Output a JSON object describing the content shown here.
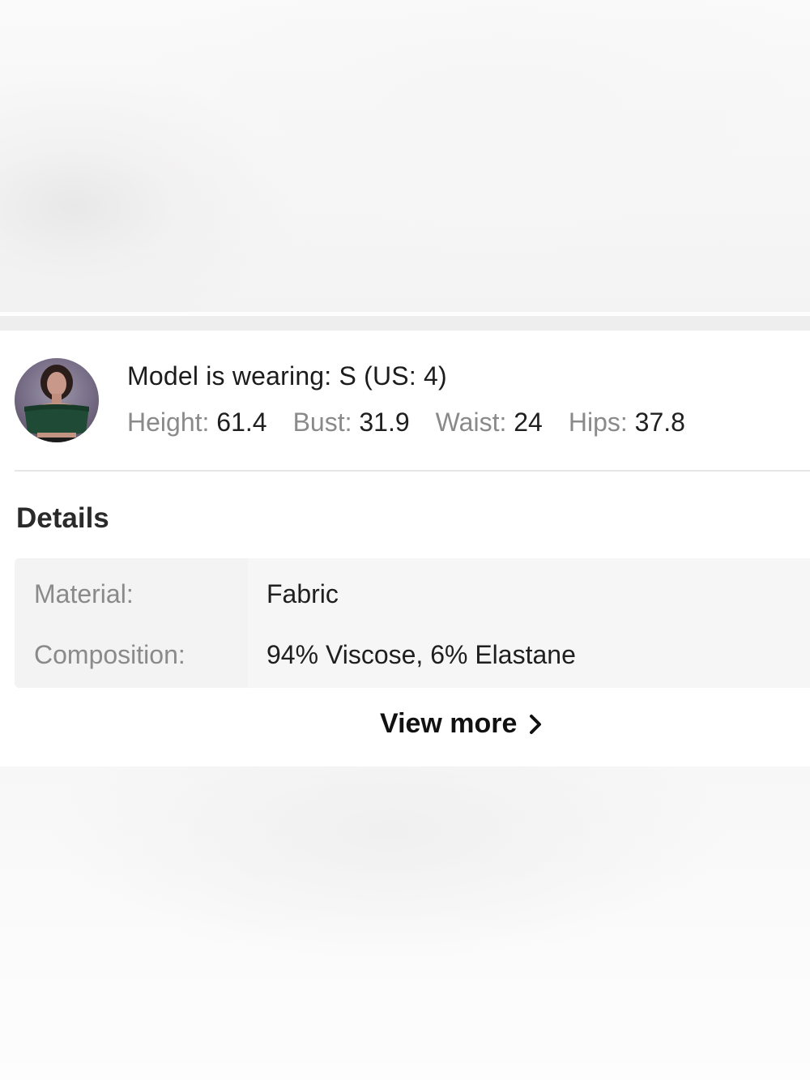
{
  "model": {
    "title": "Model is wearing: S (US: 4)",
    "measurements": [
      {
        "label": "Height: ",
        "value": "61.4"
      },
      {
        "label": "Bust: ",
        "value": "31.9"
      },
      {
        "label": "Waist: ",
        "value": "24"
      },
      {
        "label": "Hips: ",
        "value": "37.8"
      }
    ],
    "avatar_colors": {
      "top": "#6a6076",
      "outfit": "#1f4a35",
      "skin": "#b98a78"
    }
  },
  "details": {
    "title": "Details",
    "rows": [
      {
        "label": "Material:",
        "value": "Fabric"
      },
      {
        "label": "Composition:",
        "value": "94% Viscose, 6% Elastane"
      }
    ]
  },
  "view_more": {
    "label": "View more",
    "icon": "chevron-right-icon"
  }
}
